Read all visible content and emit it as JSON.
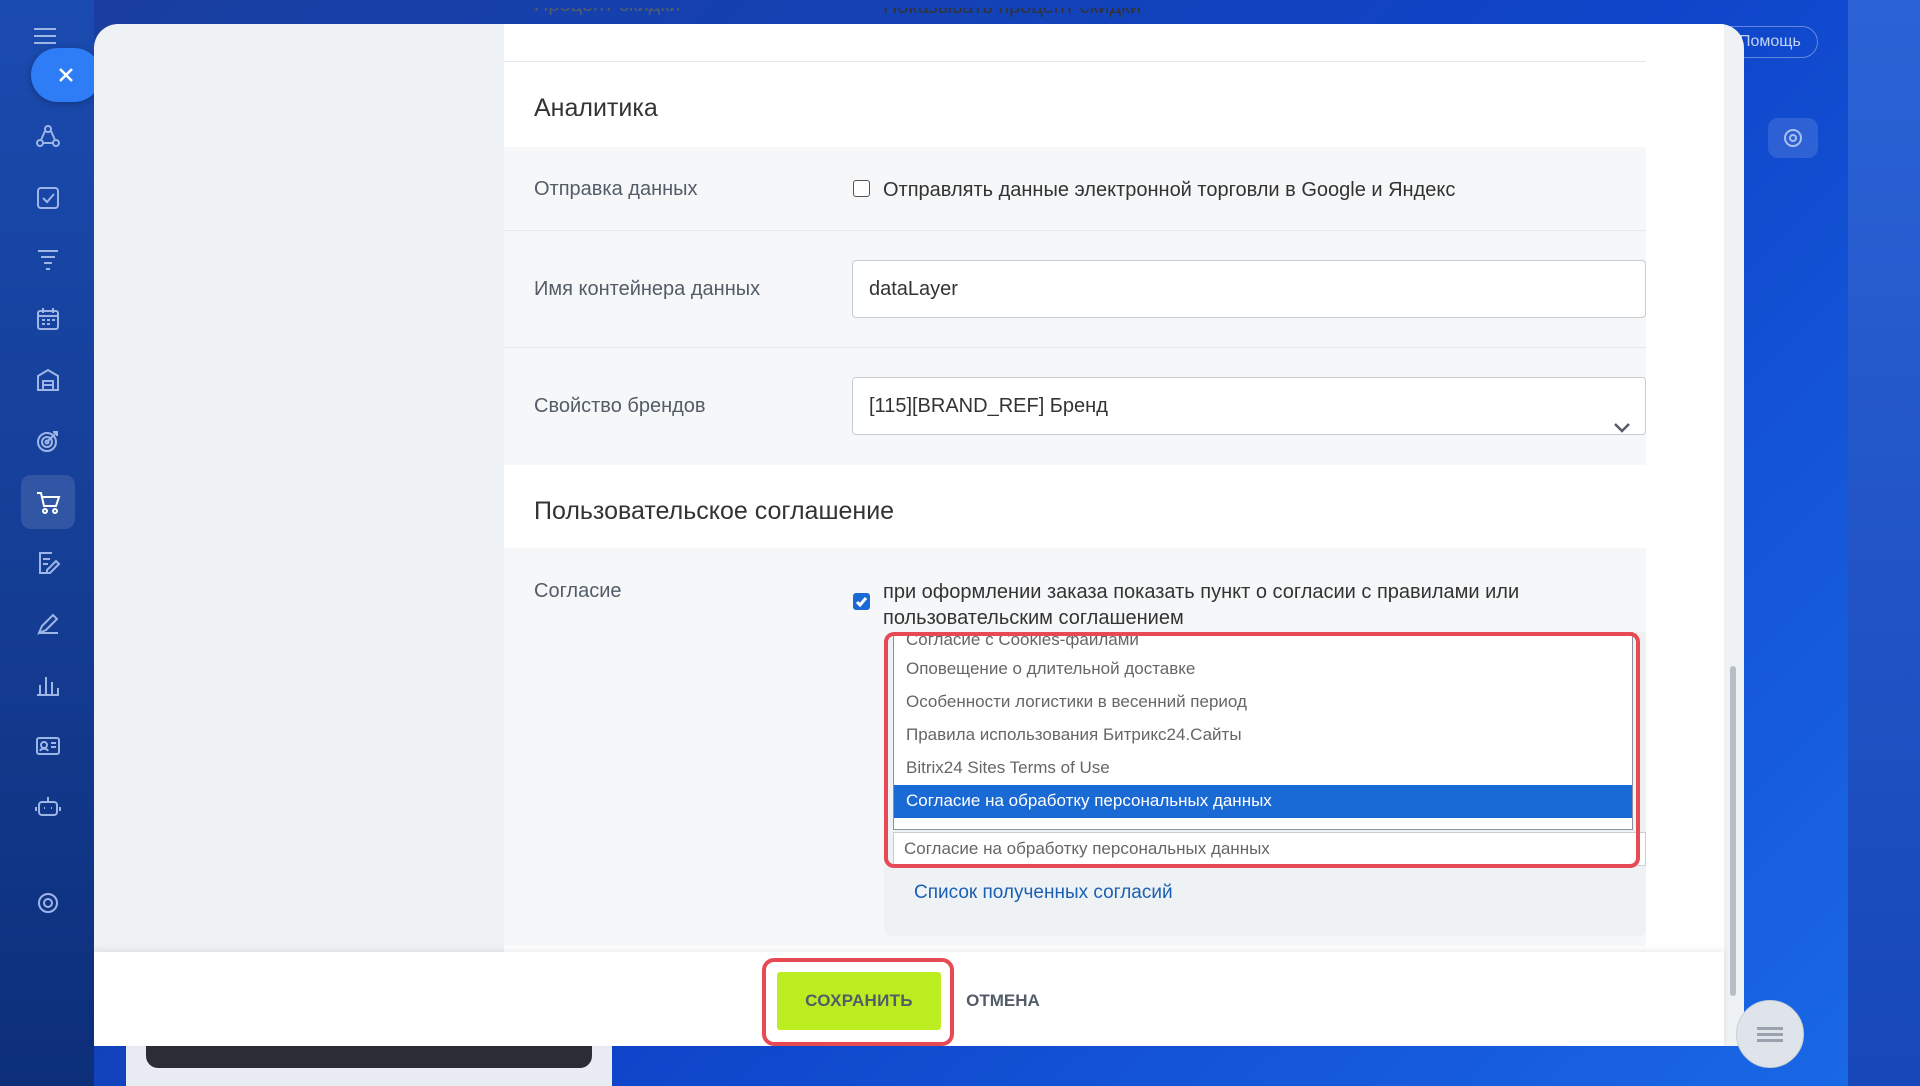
{
  "sidebar": {
    "close_label": "close",
    "icons": [
      "menu-icon",
      "crm-icon",
      "tasks-icon",
      "funnel-icon",
      "calendar-icon",
      "store-icon",
      "target-icon",
      "cart-icon",
      "document-edit-icon",
      "pen-icon",
      "analytics-icon",
      "contact-card-icon",
      "robot-icon",
      "settings-icon"
    ]
  },
  "top": {
    "help_label": "Помощь"
  },
  "form": {
    "top_partial_label": "Процент скидки",
    "top_partial_checkbox": "Показывать процент скидки",
    "analytics": {
      "heading": "Аналитика",
      "send_data_label": "Отправка данных",
      "send_data_checkbox": "Отправлять данные электронной торговли в Google и Яндекс",
      "container_label": "Имя контейнера данных",
      "container_value": "dataLayer",
      "brand_label": "Свойство брендов",
      "brand_value": "[115][BRAND_REF] Бренд"
    },
    "agreement": {
      "heading": "Пользовательское соглашение",
      "consent_label": "Согласие",
      "consent_checkbox_line1": "при оформлении заказа показать пункт о согласии с правилами или",
      "consent_checkbox_line2": "пользовательским соглашением",
      "options": [
        "Согласие с Cookies-файлами",
        "Оповещение о длительной доставке",
        "Особенности логистики в весенний период",
        "Правила использования Битрикс24.Сайты",
        "Bitrix24 Sites Terms of Use",
        "Согласие на обработку персональных данных"
      ],
      "selected_index": 5,
      "current_value": "Согласие на обработку персональных данных",
      "list_link": "Список полученных согласий"
    }
  },
  "footer": {
    "save_label": "СОХРАНИТЬ",
    "cancel_label": "ОТМЕНА"
  },
  "colors": {
    "save_button": "#bbed21",
    "highlight": "#e84a55",
    "selected_option": "#1a6ad6",
    "link": "#1a5fb4"
  }
}
